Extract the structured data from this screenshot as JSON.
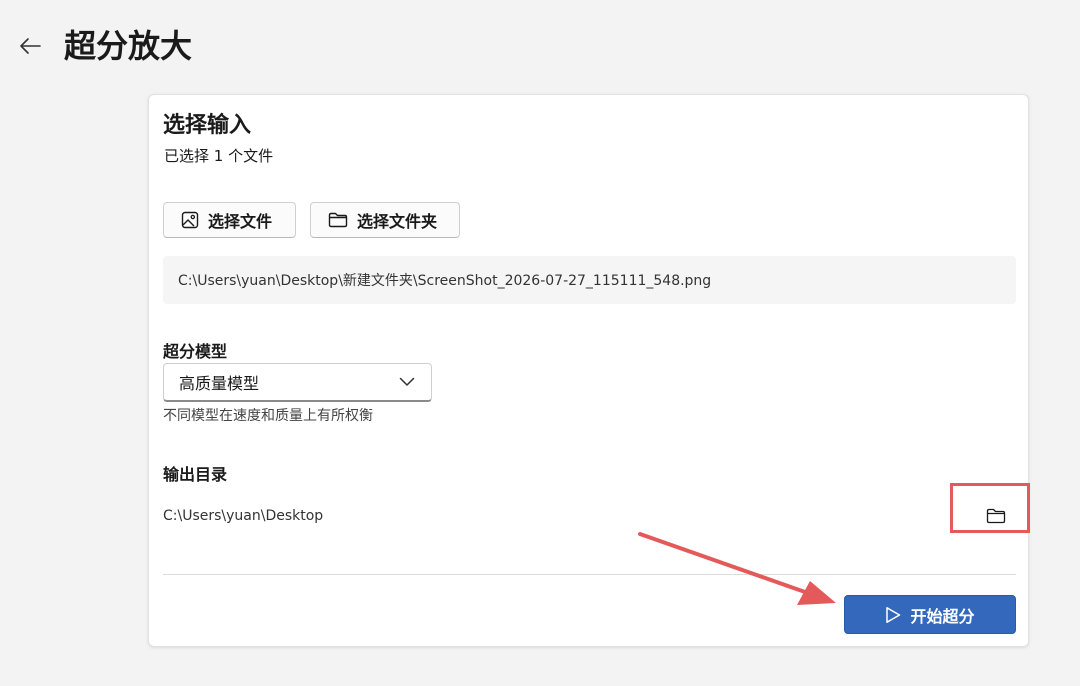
{
  "header": {
    "title": "超分放大",
    "back_icon": "arrow-left-icon"
  },
  "input_section": {
    "title": "选择输入",
    "subtitle": "已选择 1 个文件",
    "select_file_label": "选择文件",
    "select_file_icon": "image-icon",
    "select_folder_label": "选择文件夹",
    "select_folder_icon": "folder-icon",
    "selected_path": "C:\\Users\\yuan\\Desktop\\新建文件夹\\ScreenShot_2026-07-27_115111_548.png"
  },
  "model_section": {
    "label": "超分模型",
    "selected_value": "高质量模型",
    "dropdown_icon": "chevron-down-icon",
    "hint": "不同模型在速度和质量上有所权衡"
  },
  "output_section": {
    "label": "输出目录",
    "path": "C:\\Users\\yuan\\Desktop",
    "browse_icon": "folder-icon"
  },
  "actions": {
    "start_label": "开始超分",
    "start_icon": "play-icon"
  },
  "annotation": {
    "highlight_color": "#e45a5a",
    "arrow_color": "#e45a5a"
  },
  "colors": {
    "background": "#f3f3f3",
    "card": "#ffffff",
    "accent": "#3468bd"
  }
}
